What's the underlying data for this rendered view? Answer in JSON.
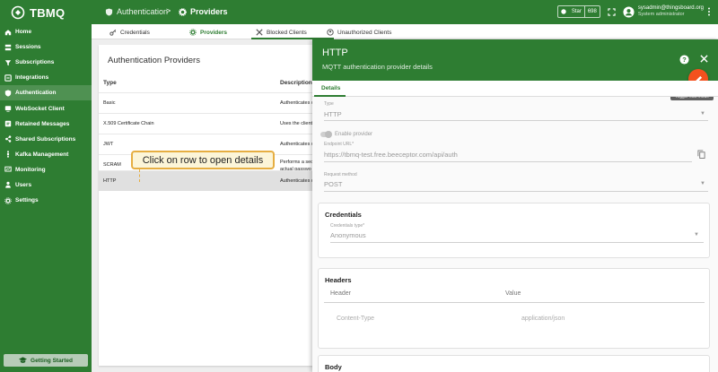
{
  "app": {
    "logo": "TBMQ"
  },
  "breadcrumb": {
    "first": "Authentication",
    "separator": ">",
    "current": "Providers"
  },
  "header": {
    "star_label": "Star",
    "star_count": "698",
    "user_name": "sysadmin@thingsboard.org",
    "user_role": "System administrator"
  },
  "sidebar": {
    "items": [
      {
        "label": "Home",
        "icon": "home-icon"
      },
      {
        "label": "Sessions",
        "icon": "sessions-icon"
      },
      {
        "label": "Subscriptions",
        "icon": "filter-icon"
      },
      {
        "label": "Integrations",
        "icon": "integrations-icon"
      },
      {
        "label": "Authentication",
        "icon": "shield-icon"
      },
      {
        "label": "WebSocket Client",
        "icon": "websocket-icon"
      },
      {
        "label": "Retained Messages",
        "icon": "retained-icon"
      },
      {
        "label": "Shared Subscriptions",
        "icon": "shared-icon"
      },
      {
        "label": "Kafka Management",
        "icon": "kafka-icon"
      },
      {
        "label": "Monitoring",
        "icon": "monitor-icon"
      },
      {
        "label": "Users",
        "icon": "users-icon"
      },
      {
        "label": "Settings",
        "icon": "gear-icon"
      }
    ],
    "getting_started": "Getting Started"
  },
  "tabs": [
    {
      "label": "Credentials"
    },
    {
      "label": "Providers"
    },
    {
      "label": "Blocked Clients"
    },
    {
      "label": "Unauthorized Clients"
    }
  ],
  "providers": {
    "title": "Authentication Providers",
    "col_type": "Type",
    "col_description": "Description",
    "rows": [
      {
        "type": "Basic",
        "desc": "Authenticates c"
      },
      {
        "type": "X.509 Certificate Chain",
        "desc": "Uses the client"
      },
      {
        "type": "JWT",
        "desc": "Authenticates c"
      },
      {
        "type": "SCRAM",
        "desc": "Performs a sec",
        "desc2": "actual passwo"
      },
      {
        "type": "HTTP",
        "desc": "Authenticates c"
      }
    ]
  },
  "callout": "Click on row to open details",
  "drawer": {
    "title": "HTTP",
    "subtitle": "MQTT authentication provider details",
    "tooltip": "Toggle edit mode",
    "tab": "Details",
    "type_label": "Type",
    "type_value": "HTTP",
    "enable_label": "Enable provider",
    "endpoint_label": "Endpoint URL*",
    "endpoint_value": "https://tbmq-test.free.beeceptor.com/api/auth",
    "method_label": "Request method",
    "method_value": "POST",
    "credentials_title": "Credentials",
    "cred_type_label": "Credentials type*",
    "cred_type_value": "Anonymous",
    "headers_title": "Headers",
    "header_col": "Header",
    "value_col": "Value",
    "header_name": "Content-Type",
    "header_value": "application/json",
    "body_title": "Body"
  }
}
